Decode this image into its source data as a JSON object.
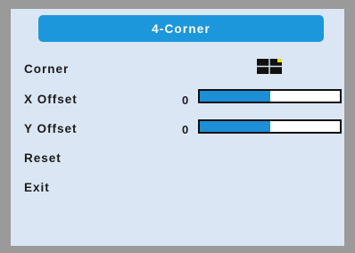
{
  "osd": {
    "title": "4-Corner",
    "items": [
      {
        "label": "Corner"
      },
      {
        "label": "X Offset",
        "value": "0",
        "slider_fraction": 0.5
      },
      {
        "label": "Y Offset",
        "value": "0",
        "slider_fraction": 0.5
      },
      {
        "label": "Reset"
      },
      {
        "label": "Exit"
      }
    ],
    "colors": {
      "title_bar": "#1c97dc",
      "panel_background": "#dbe6f4",
      "frame": "#9a9a9a",
      "slider_fill": "#1c8fd6",
      "corner_highlight": "#f0e000"
    },
    "corner_icon": "quad-grid-top-right-selected-icon"
  }
}
